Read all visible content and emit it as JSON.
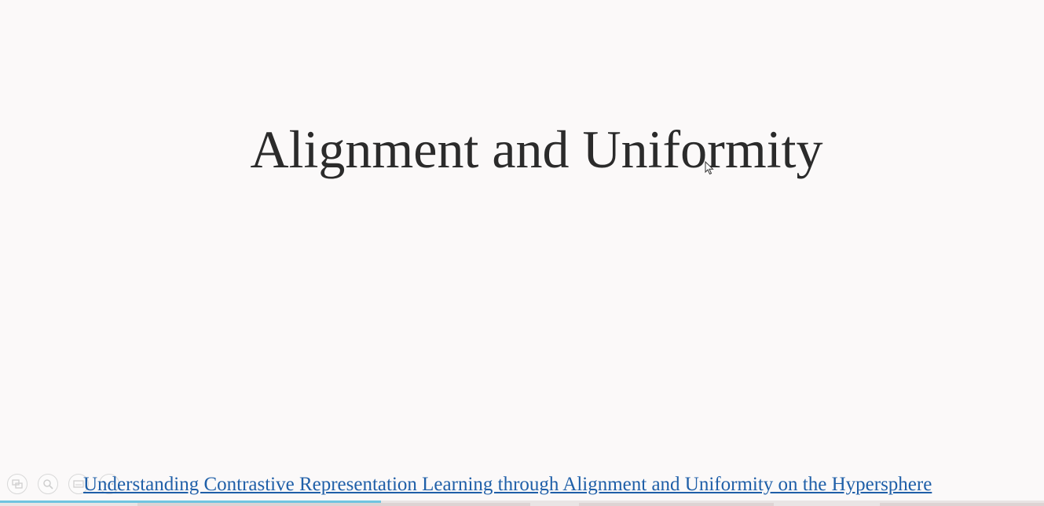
{
  "slide": {
    "title": "Alignment and Uniformity",
    "reference_link": "Understanding Contrastive Representation Learning through Alignment and Uniformity on the Hypersphere"
  },
  "controls": [
    {
      "name": "slides-overview-icon"
    },
    {
      "name": "zoom-icon"
    },
    {
      "name": "captions-icon"
    },
    {
      "name": "more-options-icon"
    }
  ],
  "progress": {
    "fraction": 0.365
  },
  "colors": {
    "background": "#fbf9f9",
    "title": "#2b2b2b",
    "link": "#1f5fa8",
    "progress": "#6fc4e0"
  }
}
